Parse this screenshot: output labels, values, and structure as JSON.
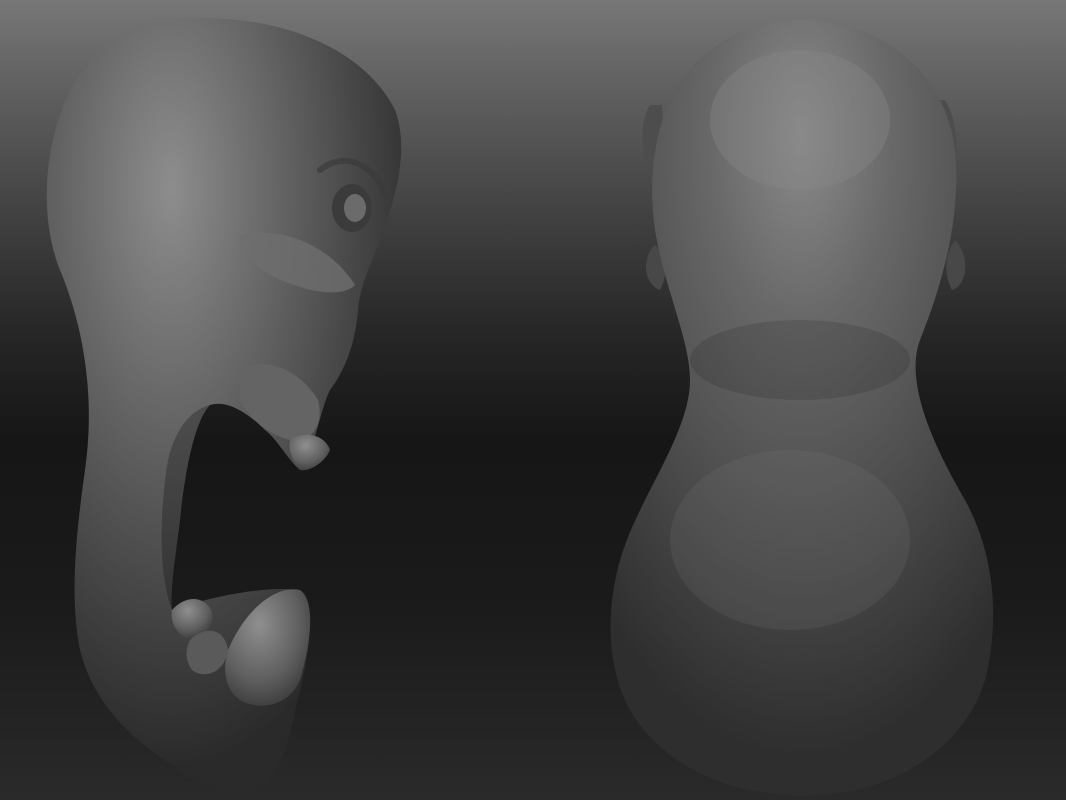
{
  "scene": {
    "description_visible_text": "",
    "views": [
      {
        "view": "side",
        "subject": "creature-head-sculpt",
        "shading": "matcap-gray"
      },
      {
        "view": "back",
        "subject": "creature-head-sculpt",
        "shading": "matcap-gray"
      }
    ],
    "colors": {
      "background_top": "#777777",
      "background_bottom": "#161616",
      "clay_light": "#8c8c8c",
      "clay_mid": "#5e5e5e",
      "clay_dark": "#2c2c2c"
    }
  }
}
